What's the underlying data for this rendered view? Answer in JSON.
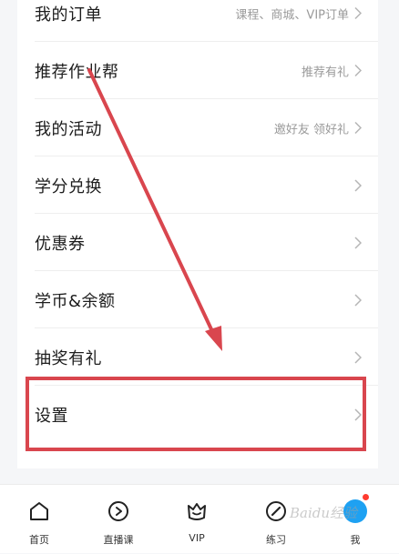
{
  "menu": {
    "items": [
      {
        "label": "我的订单",
        "sub": "课程、商城、VIP订单"
      },
      {
        "label": "推荐作业帮",
        "sub": "推荐有礼"
      },
      {
        "label": "我的活动",
        "sub": "邀好友 领好礼"
      },
      {
        "label": "学分兑换",
        "sub": ""
      },
      {
        "label": "优惠券",
        "sub": ""
      },
      {
        "label": "学币&余额",
        "sub": ""
      },
      {
        "label": "抽奖有礼",
        "sub": ""
      },
      {
        "label": "设置",
        "sub": ""
      }
    ]
  },
  "tabbar": {
    "tabs": [
      {
        "label": "首页",
        "icon": "home-icon"
      },
      {
        "label": "直播课",
        "icon": "play-icon"
      },
      {
        "label": "VIP",
        "icon": "vip-crown-icon"
      },
      {
        "label": "练习",
        "icon": "pencil-icon"
      },
      {
        "label": "我",
        "icon": "me-icon"
      }
    ]
  },
  "colors": {
    "annotation": "#d9464e",
    "accent": "#1ea1f2",
    "badge": "#ff3b30"
  },
  "watermark": "Baidu经验"
}
